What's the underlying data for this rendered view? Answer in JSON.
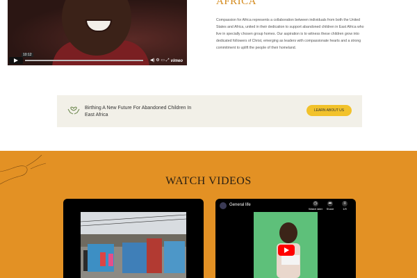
{
  "top_video": {
    "time_tooltip": "10:12",
    "brand": "vimeo",
    "controls": [
      "volume-icon",
      "settings-icon",
      "pip-icon",
      "fullscreen-icon"
    ]
  },
  "intro": {
    "title": "AFRICA",
    "body": "Compassion for Africa represents a collaboration between individuals from both the United States and Africa, united in their dedication to support abandoned children in East Africa who live in specially chosen group homes. Our aspiration is to witness these children grow into dedicated followers of Christ, emerging as leaders with compassionate hearts and a strong commitment to uplift the people of their homeland."
  },
  "banner": {
    "title": "Birthing A New Future For Abandoned Children In East Africa",
    "button": "LEARN ABOUT US"
  },
  "videos_section": {
    "title": "WATCH VIDEOS",
    "video2": {
      "title": "General life",
      "watch_later": "Watch later",
      "share": "Share",
      "counter": "1/9"
    }
  },
  "colors": {
    "accent": "#d48a1c",
    "orange_bg": "#e39124",
    "button_yellow": "#f2c22b",
    "banner_bg": "#f2f0e8"
  }
}
